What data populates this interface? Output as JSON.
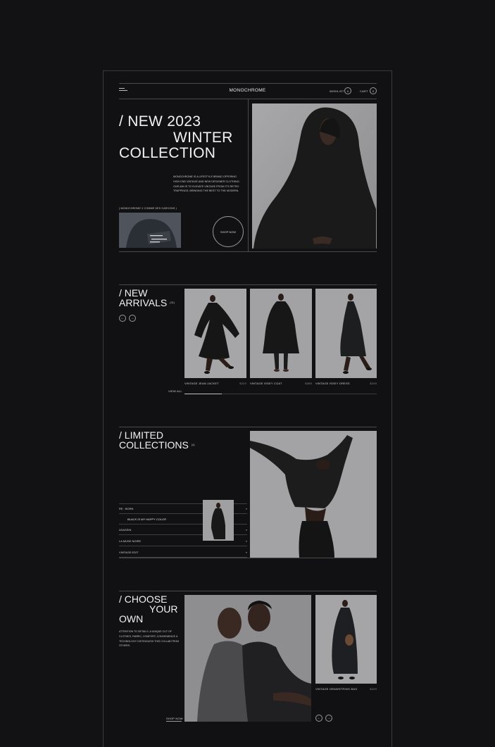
{
  "header": {
    "brand": "MONOCHROME",
    "wishlist_label": "WISHLIST",
    "wishlist_count": "0",
    "cart_label": "CART",
    "cart_count": "0"
  },
  "hero": {
    "line1": "/ NEW 2023",
    "line2": "WINTER",
    "line3": "COLLECTION",
    "description": "MONOCHROME IS A LIFESTYLE BRAND OFFERING HIGH END VINTAGE AND NEW DESIGNER CLOTHING. OUR AIM IS TO ELEVATE VINTAGE FROM IT'S RETRO TRAPPINGS, BRINGING THE BEST TO THE MODERN.",
    "collab": "( MONOCHROME X COMME DES GARCONS )",
    "shop_now": "SHOP NOW"
  },
  "new_arrivals": {
    "line1": "/ NEW",
    "line2": "ARRIVALS",
    "count": "(31)",
    "view_all": "VIEW ALL",
    "products": [
      {
        "name": "VINTAGE JEAN JACKET",
        "price": "$220"
      },
      {
        "name": "VINTAGE ISSEY COAT",
        "price": "$385"
      },
      {
        "name": "VINTAGE ISSEY DRESS",
        "price": "$249"
      }
    ]
  },
  "limited": {
    "line1": "/ LIMITED",
    "line2": "COLLECTIONS",
    "count": "(4)",
    "items": [
      "RE : BORN",
      "BLACK IS MY HAPPY COLOR",
      "ASASSIN",
      "LA MUSE NOIRE",
      "VINTAGE EDIT"
    ],
    "arrow": "»"
  },
  "choose": {
    "line1": "/ CHOOSE",
    "line2": "YOUR",
    "line3": "OWN",
    "description": "ATTENTION TO DETAILS, A UNIQUE CUT OF CLOTHES, FABRIC, COMFORT, CONVENIENCE & TECHNOLOGY DISTINGUISH THIS COLLAB FROM OTHERS.",
    "shop_now": "SHOP NOW",
    "product": {
      "name": "VINTAGE DRAWSTRING BAG",
      "price": "$249"
    }
  }
}
